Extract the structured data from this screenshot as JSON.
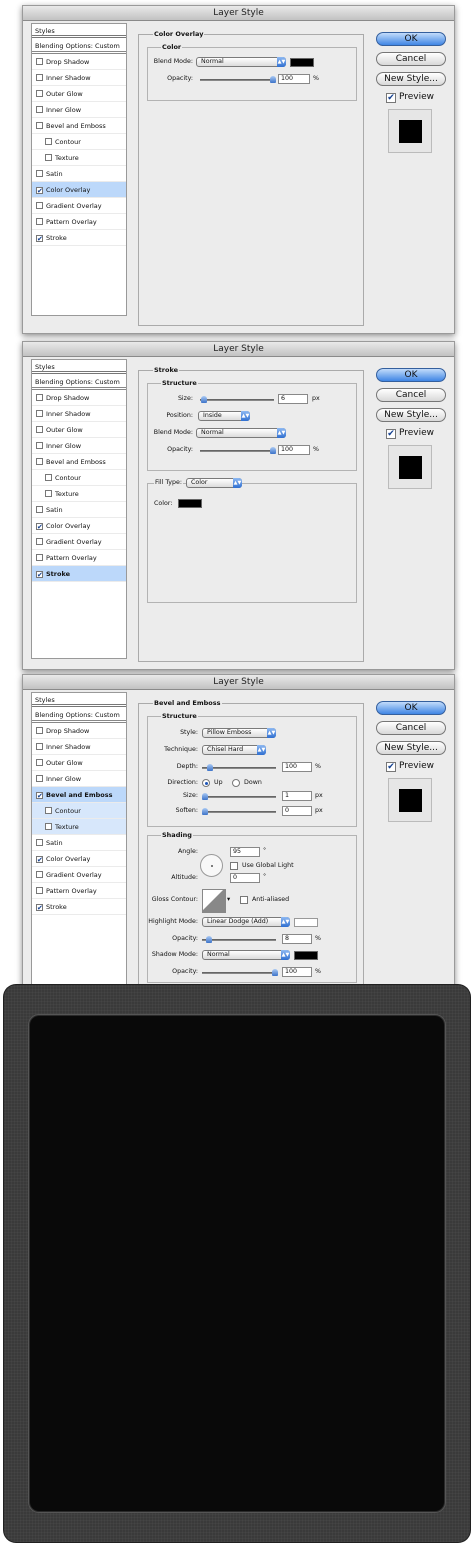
{
  "dialogs": [
    {
      "title": "Layer Style",
      "panel_title": "Color Overlay",
      "group_title": "Color",
      "blend_mode_label": "Blend Mode:",
      "blend_mode_value": "Normal",
      "opacity_label": "Opacity:",
      "opacity_value": "100",
      "opacity_unit": "%",
      "color": "#000000"
    },
    {
      "title": "Layer Style",
      "panel_title": "Stroke",
      "group_title": "Structure",
      "size_label": "Size:",
      "size_value": "6",
      "size_unit": "px",
      "position_label": "Position:",
      "position_value": "Inside",
      "blend_mode_label": "Blend Mode:",
      "blend_mode_value": "Normal",
      "opacity_label": "Opacity:",
      "opacity_value": "100",
      "opacity_unit": "%",
      "fill_type_label": "Fill Type:",
      "fill_type_value": "Color",
      "color_label": "Color:",
      "color": "#000000"
    },
    {
      "title": "Layer Style",
      "panel_title": "Bevel and Emboss",
      "group_title": "Structure",
      "style_label": "Style:",
      "style_value": "Pillow Emboss",
      "technique_label": "Technique:",
      "technique_value": "Chisel Hard",
      "depth_label": "Depth:",
      "depth_value": "100",
      "depth_unit": "%",
      "direction_label": "Direction:",
      "direction_up": "Up",
      "direction_down": "Down",
      "size_label": "Size:",
      "size_value": "1",
      "size_unit": "px",
      "soften_label": "Soften:",
      "soften_value": "0",
      "soften_unit": "px",
      "shading_title": "Shading",
      "angle_label": "Angle:",
      "angle_value": "95",
      "angle_unit": "°",
      "global_light_label": "Use Global Light",
      "altitude_label": "Altitude:",
      "altitude_value": "0",
      "altitude_unit": "°",
      "gloss_label": "Gloss Contour:",
      "anti_aliased_label": "Anti-aliased",
      "highlight_label": "Highlight Mode:",
      "highlight_value": "Linear Dodge (Add)",
      "highlight_opacity_label": "Opacity:",
      "highlight_opacity_value": "8",
      "highlight_opacity_unit": "%",
      "shadow_label": "Shadow Mode:",
      "shadow_value": "Normal",
      "shadow_opacity_label": "Opacity:",
      "shadow_opacity_value": "100",
      "shadow_opacity_unit": "%",
      "highlight_color": "#ffffff",
      "shadow_color": "#000000"
    }
  ],
  "sidebar": {
    "header": "Styles",
    "blending": "Blending Options: Custom",
    "items": [
      "Drop Shadow",
      "Inner Shadow",
      "Outer Glow",
      "Inner Glow",
      "Bevel and Emboss",
      "Contour",
      "Texture",
      "Satin",
      "Color Overlay",
      "Gradient Overlay",
      "Pattern Overlay",
      "Stroke"
    ]
  },
  "buttons": {
    "ok": "OK",
    "cancel": "Cancel",
    "new_style": "New Style...",
    "preview": "Preview"
  },
  "checkmark": "✔",
  "colors": {
    "selection": "#bcd8fa",
    "accent": "#3f85e4",
    "dialog_bg": "#ececec"
  }
}
